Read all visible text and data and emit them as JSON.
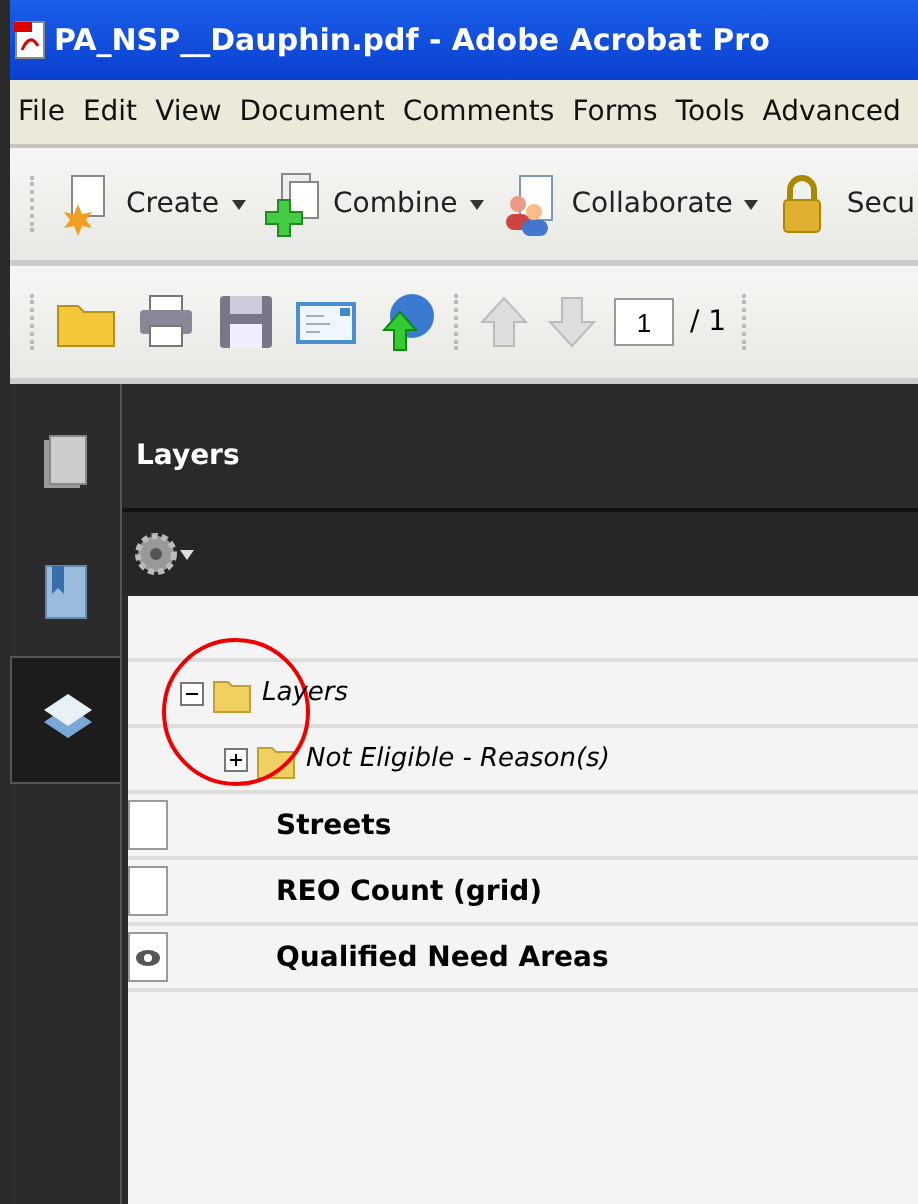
{
  "window": {
    "title": "PA_NSP__Dauphin.pdf - Adobe Acrobat Pro"
  },
  "menu": [
    "File",
    "Edit",
    "View",
    "Document",
    "Comments",
    "Forms",
    "Tools",
    "Advanced"
  ],
  "task_toolbar": [
    {
      "label": "Create",
      "kind": "create"
    },
    {
      "label": "Combine",
      "kind": "combine"
    },
    {
      "label": "Collaborate",
      "kind": "collaborate"
    },
    {
      "label": "Secu",
      "kind": "secure"
    }
  ],
  "file_toolbar": {
    "tools": [
      {
        "kind": "open"
      },
      {
        "kind": "print"
      },
      {
        "kind": "save"
      },
      {
        "kind": "email"
      },
      {
        "kind": "upload"
      }
    ],
    "page": "1",
    "page_total": "/ 1"
  },
  "nav": [
    {
      "kind": "pages",
      "selected": false
    },
    {
      "kind": "bookmarks",
      "selected": false
    },
    {
      "kind": "layers",
      "selected": true
    }
  ],
  "panel": {
    "title": "Layers"
  },
  "tree": [
    {
      "label": "Layers",
      "expanded": true,
      "children": [
        {
          "label": "Not Eligible - Reason(s)",
          "expanded": false
        }
      ]
    }
  ],
  "layers": [
    {
      "name": "Streets",
      "visible": false
    },
    {
      "name": "REO Count (grid)",
      "visible": false
    },
    {
      "name": "Qualified Need Areas",
      "visible": true
    }
  ],
  "annotation": {
    "kind": "circle"
  }
}
